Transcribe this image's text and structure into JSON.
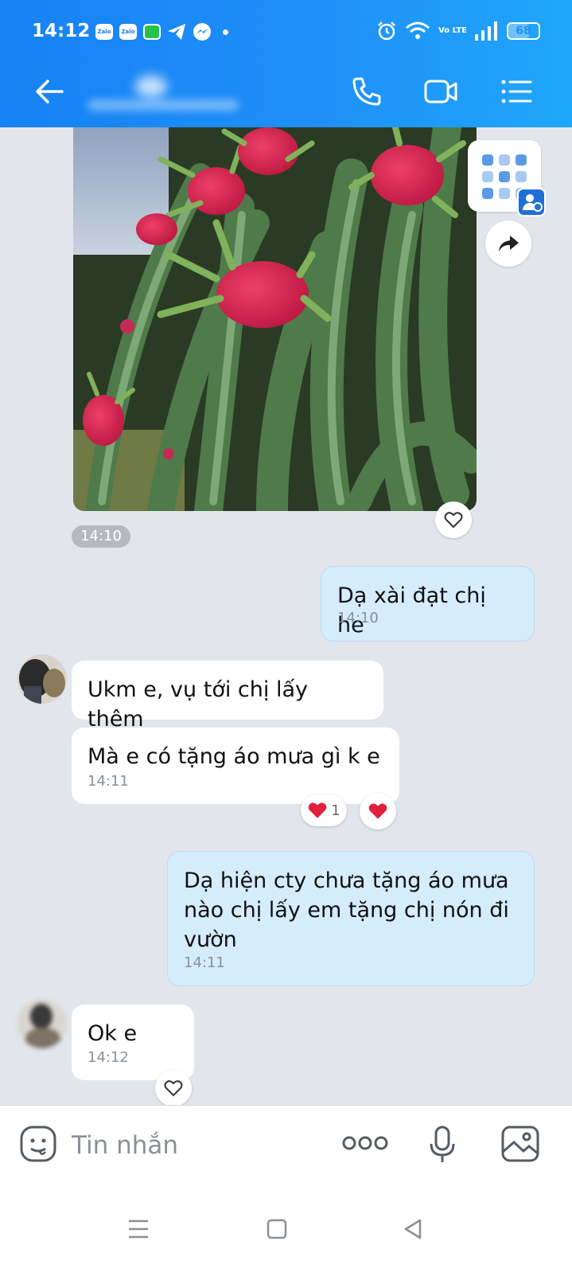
{
  "status_bar": {
    "time": "14:12",
    "notification_icons": [
      "zalo-icon",
      "zalo-icon",
      "green-app-icon",
      "telegram-icon",
      "messenger-icon"
    ],
    "network": "Vo LTE",
    "battery": "68",
    "battery_level": 0.68
  },
  "header": {
    "actions": [
      "phone-call-icon",
      "video-call-icon",
      "menu-list-icon"
    ]
  },
  "colors": {
    "header_gradient_start": "#1682f5",
    "header_gradient_end": "#1fa7fb",
    "outgoing_bubble": "#d5ecfc",
    "incoming_bubble": "#ffffff",
    "chat_background": "#e2e6ec"
  },
  "messages": [
    {
      "id": "photo",
      "side": "incoming",
      "type": "image",
      "time": "14:10"
    },
    {
      "id": "m1",
      "side": "outgoing",
      "text": "Dạ xài đạt chị he",
      "time": "14:10"
    },
    {
      "id": "m2",
      "side": "incoming",
      "text": "Ukm e, vụ tới chị lấy thêm"
    },
    {
      "id": "m3",
      "side": "incoming",
      "text": "Mà e có tặng áo mưa gì k e",
      "time": "14:11",
      "reaction_count": "1"
    },
    {
      "id": "m4",
      "side": "outgoing",
      "lines": [
        "Dạ hiện cty chưa tặng áo mưa",
        "nào chị lấy em tặng chị nón đi",
        "vườn"
      ],
      "time": "14:11"
    },
    {
      "id": "m5",
      "side": "incoming",
      "text": "Ok e",
      "time": "14:12"
    }
  ],
  "composer": {
    "placeholder": "Tin nhắn"
  }
}
